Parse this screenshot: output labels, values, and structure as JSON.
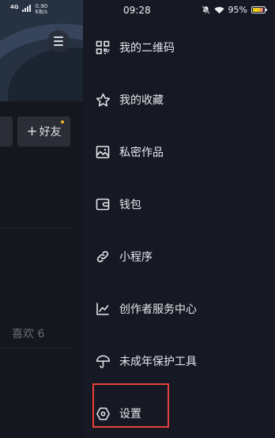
{
  "status_bar": {
    "network_type": "4G",
    "network_speed_value": "0.90",
    "network_speed_unit": "KB/s",
    "time": "09:28",
    "battery_percent": "95%",
    "battery_level": 0.95
  },
  "background_page": {
    "add_friend_label": "好友",
    "add_friend_plus": "+",
    "likes_tab_label": "喜欢 6"
  },
  "drawer": {
    "items": [
      {
        "label": "我的二维码",
        "icon": "qr-code-icon"
      },
      {
        "label": "我的收藏",
        "icon": "star-icon"
      },
      {
        "label": "私密作品",
        "icon": "image-icon"
      },
      {
        "label": "钱包",
        "icon": "wallet-icon"
      },
      {
        "label": "小程序",
        "icon": "link-icon"
      },
      {
        "label": "创作者服务中心",
        "icon": "chart-icon"
      },
      {
        "label": "未成年保护工具",
        "icon": "umbrella-icon"
      },
      {
        "label": "设置",
        "icon": "settings-hexagon-icon"
      }
    ]
  },
  "colors": {
    "background": "#161823",
    "highlight": "#e8403b",
    "text": "#e6e7ec"
  }
}
